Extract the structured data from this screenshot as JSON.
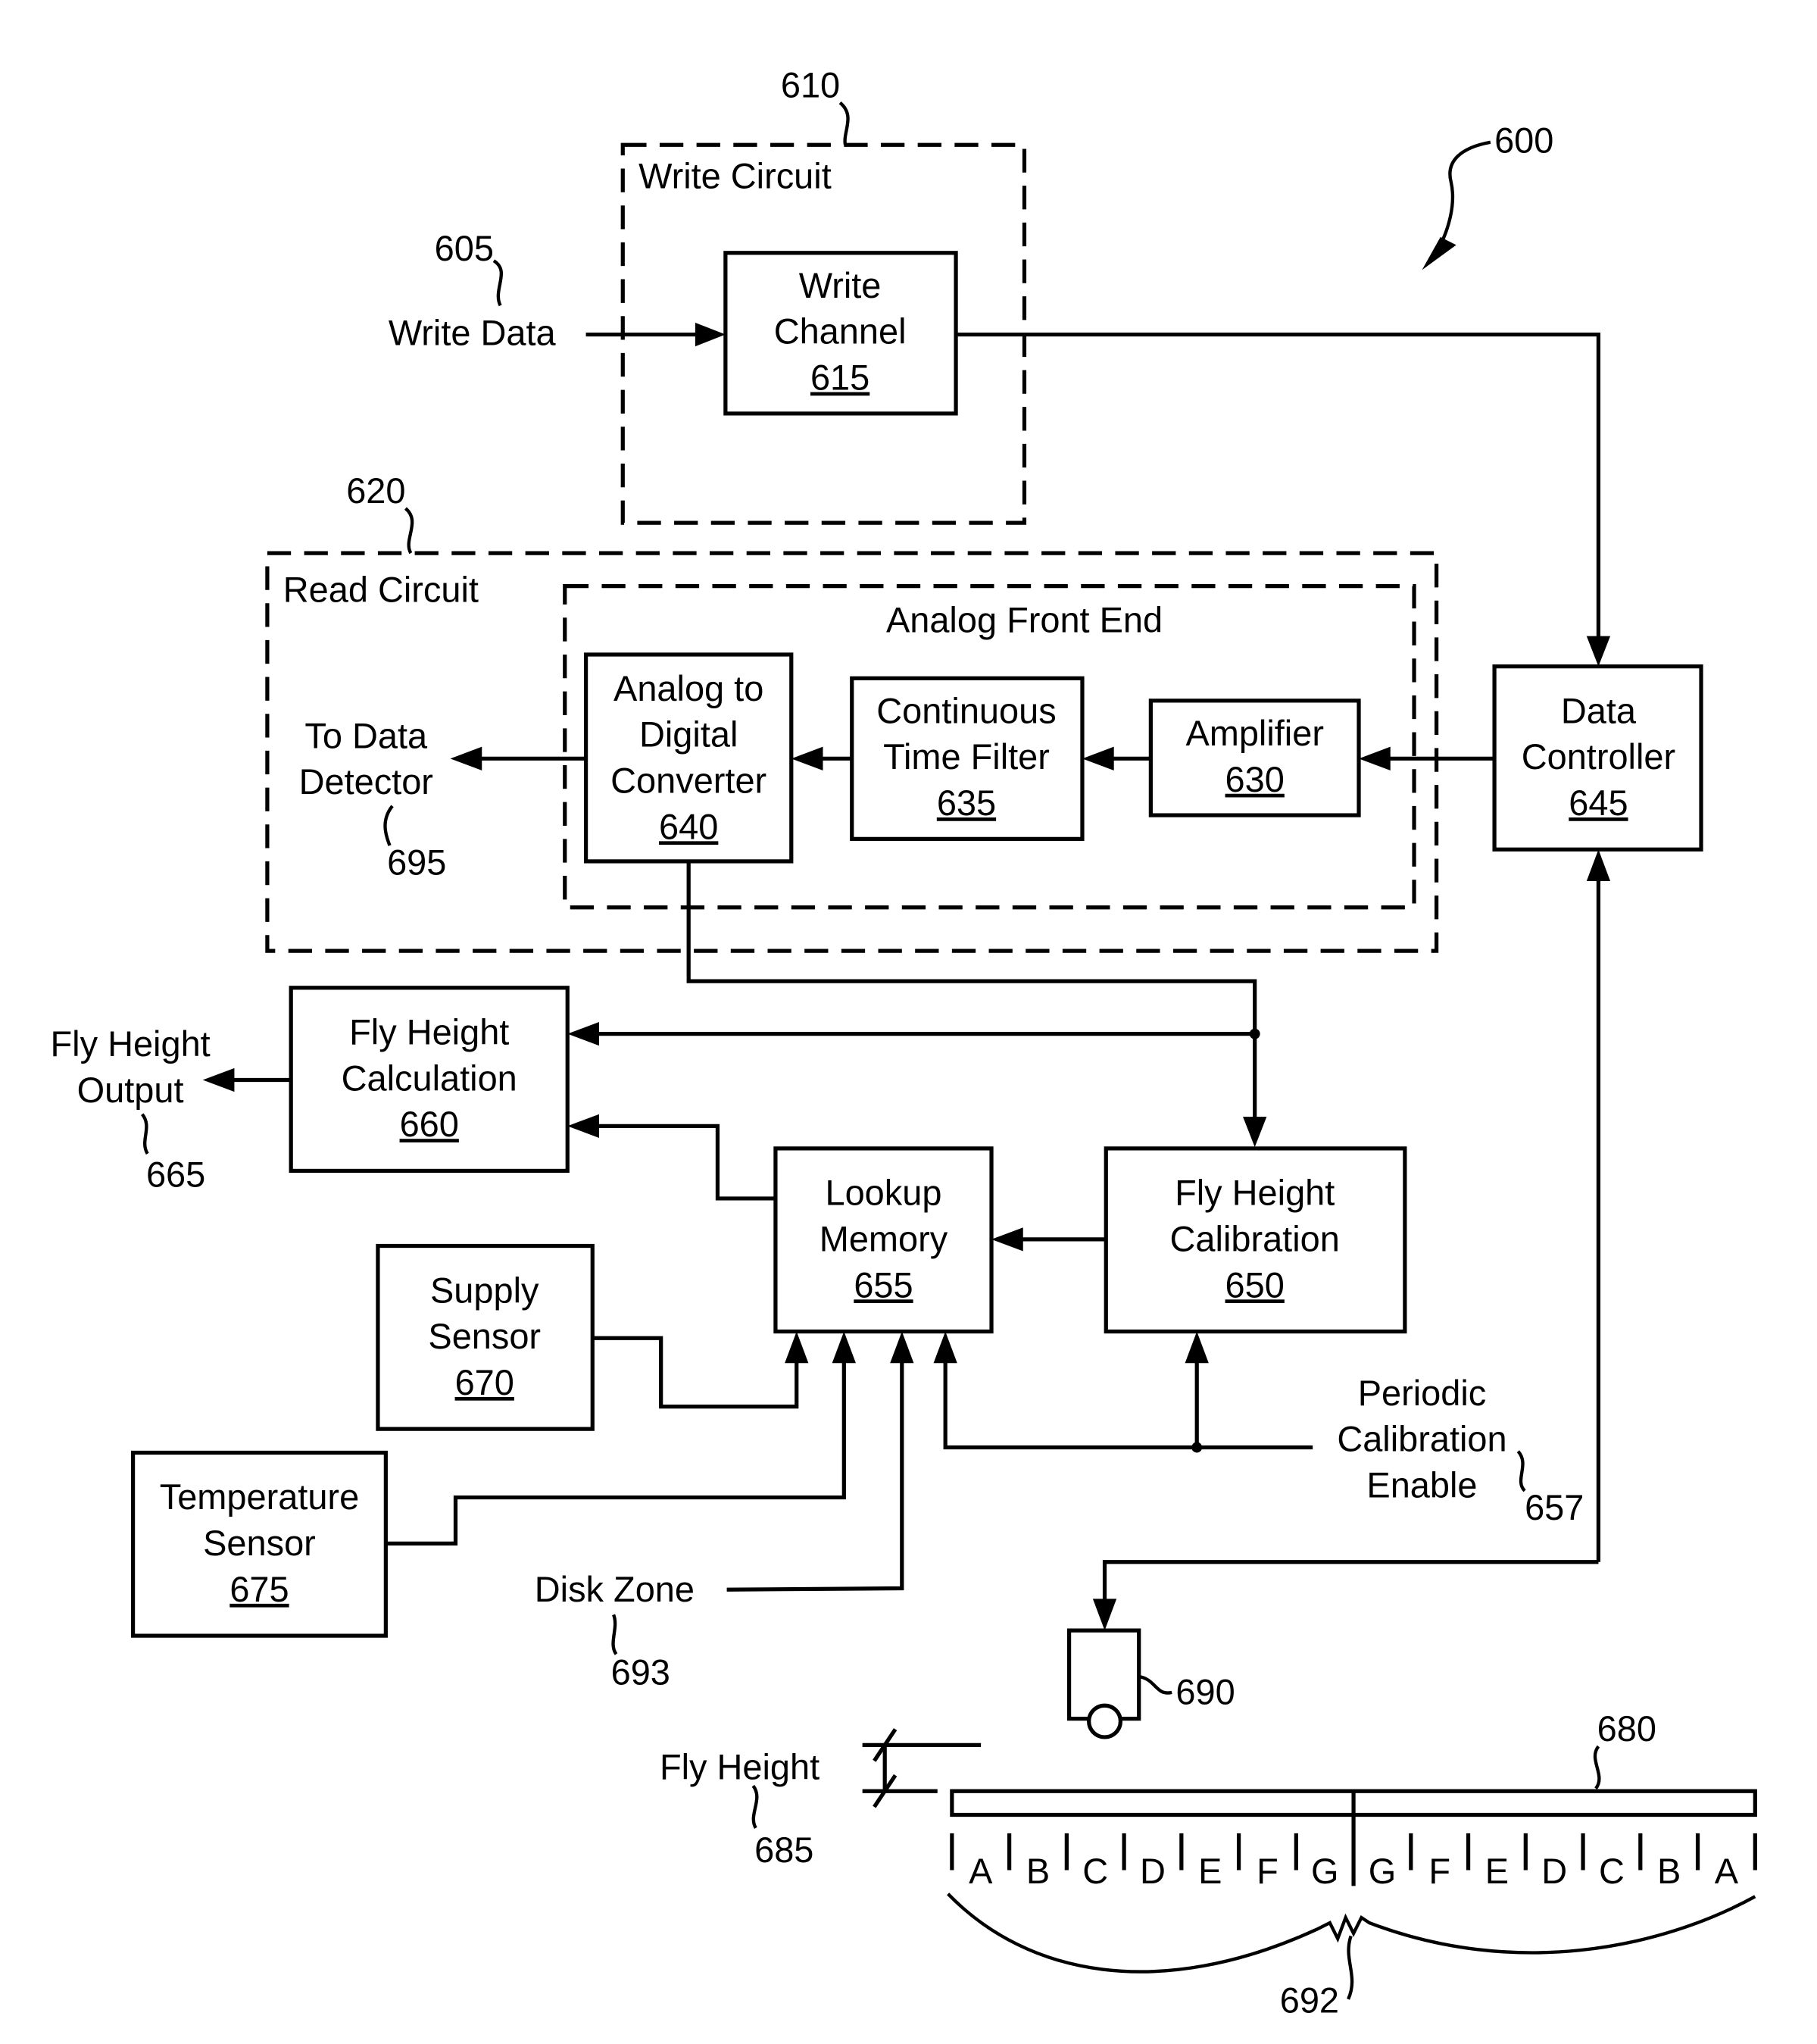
{
  "figure": {
    "ref": "600"
  },
  "write_circuit": {
    "label": "Write Circuit",
    "ref": "610",
    "write_data": {
      "label": "Write Data",
      "ref": "605"
    },
    "write_channel": {
      "line1": "Write",
      "line2": "Channel",
      "ref": "615"
    }
  },
  "read_circuit": {
    "label": "Read Circuit",
    "ref": "620",
    "to_data_detector": {
      "line1": "To Data",
      "line2": "Detector",
      "ref": "695"
    },
    "analog_front_end": {
      "label": "Analog Front End",
      "adc": {
        "line1": "Analog to",
        "line2": "Digital",
        "line3": "Converter",
        "ref": "640"
      },
      "ctf": {
        "line1": "Continuous",
        "line2": "Time Filter",
        "ref": "635"
      },
      "amplifier": {
        "line1": "Amplifier",
        "ref": "630"
      }
    }
  },
  "data_controller": {
    "line1": "Data",
    "line2": "Controller",
    "ref": "645"
  },
  "fly_height_calculation": {
    "line1": "Fly Height",
    "line2": "Calculation",
    "ref": "660"
  },
  "fly_height_output": {
    "line1": "Fly Height",
    "line2": "Output",
    "ref": "665"
  },
  "lookup_memory": {
    "line1": "Lookup",
    "line2": "Memory",
    "ref": "655"
  },
  "fly_height_calibration": {
    "line1": "Fly Height",
    "line2": "Calibration",
    "ref": "650"
  },
  "supply_sensor": {
    "line1": "Supply",
    "line2": "Sensor",
    "ref": "670"
  },
  "temperature_sensor": {
    "line1": "Temperature",
    "line2": "Sensor",
    "ref": "675"
  },
  "periodic_calibration_enable": {
    "line1": "Periodic",
    "line2": "Calibration",
    "line3": "Enable",
    "ref": "657"
  },
  "disk_zone": {
    "label": "Disk Zone",
    "ref": "693"
  },
  "head": {
    "ref": "690"
  },
  "disk": {
    "ref": "680"
  },
  "fly_height": {
    "label": "Fly Height",
    "ref": "685"
  },
  "zones": {
    "ref": "692",
    "labels": [
      "A",
      "B",
      "C",
      "D",
      "E",
      "F",
      "G",
      "G",
      "F",
      "E",
      "D",
      "C",
      "B",
      "A"
    ]
  }
}
